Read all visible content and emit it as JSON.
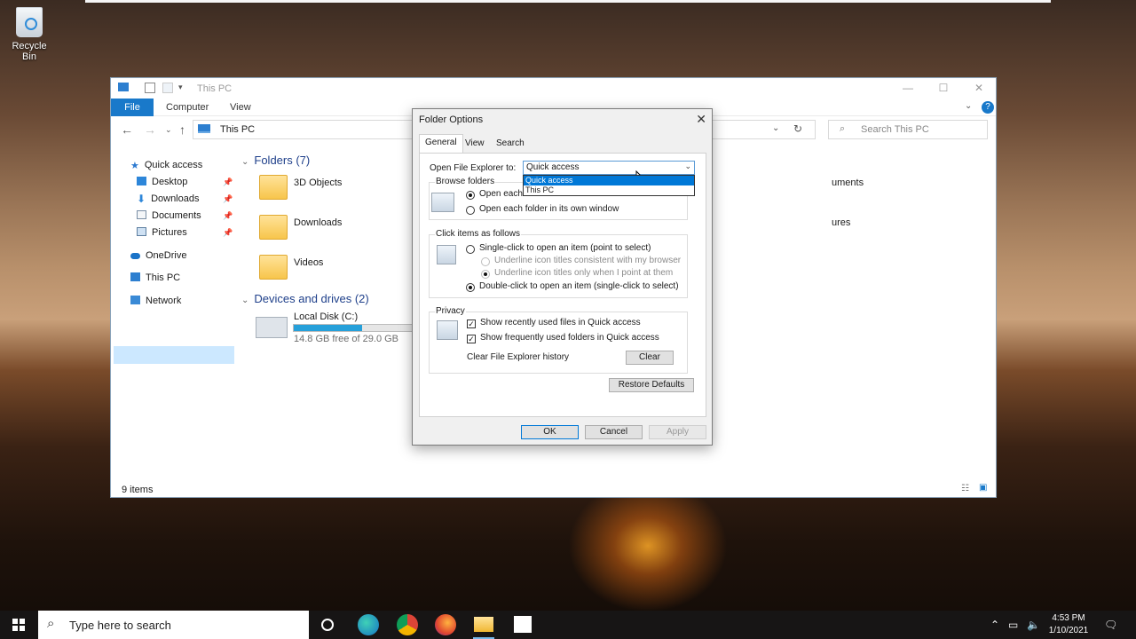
{
  "desktop": {
    "recycle_bin": "Recycle Bin"
  },
  "explorer": {
    "title": "This PC",
    "ribbon_tabs": [
      "File",
      "Computer",
      "View"
    ],
    "address": "This PC",
    "search_placeholder": "Search This PC",
    "sidebar": {
      "quick_access": "Quick access",
      "desktop": "Desktop",
      "downloads": "Downloads",
      "documents": "Documents",
      "pictures": "Pictures",
      "onedrive": "OneDrive",
      "this_pc": "This PC",
      "network": "Network"
    },
    "folders_header": "Folders (7)",
    "folders": [
      "3D Objects",
      "Downloads",
      "Videos"
    ],
    "partial_right": [
      "uments",
      "ures"
    ],
    "devices_header": "Devices and drives (2)",
    "drive": {
      "name": "Local Disk (C:)",
      "free": "14.8 GB free of 29.0 GB",
      "used_fraction": 0.49
    },
    "status": "9 items"
  },
  "dialog": {
    "title": "Folder Options",
    "tabs": [
      "General",
      "View",
      "Search"
    ],
    "open_to_label": "Open File Explorer to:",
    "open_to_value": "Quick access",
    "dropdown_options": [
      "Quick access",
      "This PC"
    ],
    "browse_title": "Browse folders",
    "browse_same": "Open each folder in the same window",
    "browse_own": "Open each folder in its own window",
    "click_title": "Click items as follows",
    "single_click": "Single-click to open an item (point to select)",
    "underline_browser": "Underline icon titles consistent with my browser",
    "underline_point": "Underline icon titles only when I point at them",
    "double_click": "Double-click to open an item (single-click to select)",
    "privacy_title": "Privacy",
    "recent_files": "Show recently used files in Quick access",
    "frequent_folders": "Show frequently used folders in Quick access",
    "clear_history": "Clear File Explorer history",
    "clear": "Clear",
    "restore": "Restore Defaults",
    "ok": "OK",
    "cancel": "Cancel",
    "apply": "Apply"
  },
  "taskbar": {
    "search_placeholder": "Type here to search",
    "time": "4:53 PM",
    "date": "1/10/2021"
  }
}
